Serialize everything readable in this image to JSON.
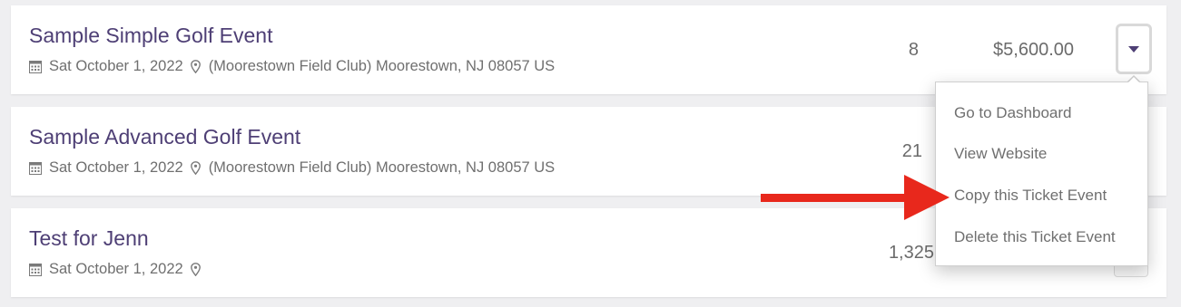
{
  "events": [
    {
      "title": "Sample Simple Golf Event",
      "date": "Sat October 1, 2022",
      "location": "(Moorestown Field Club) Moorestown, NJ 08057 US",
      "count": "8",
      "amount": "$5,600.00"
    },
    {
      "title": "Sample Advanced Golf Event",
      "date": "Sat October 1, 2022",
      "location": "(Moorestown Field Club) Moorestown, NJ 08057 US",
      "count": "21",
      "amount": ""
    },
    {
      "title": "Test for Jenn",
      "date": "Sat October 1, 2022",
      "location": "",
      "count": "1,325",
      "amount": ""
    }
  ],
  "dropdown": {
    "items": [
      {
        "label": "Go to Dashboard"
      },
      {
        "label": "View Website"
      },
      {
        "label": "Copy this Ticket Event"
      },
      {
        "label": "Delete this Ticket Event"
      }
    ]
  },
  "icons": {
    "calendar": "calendar-icon",
    "location": "map-pin-icon",
    "toggle": "caret-down-icon",
    "annotation": "red-arrow"
  },
  "colors": {
    "title": "#4e3f75",
    "text": "#6f6f6f",
    "arrow": "#e8281c",
    "caret": "#4e3f75"
  }
}
